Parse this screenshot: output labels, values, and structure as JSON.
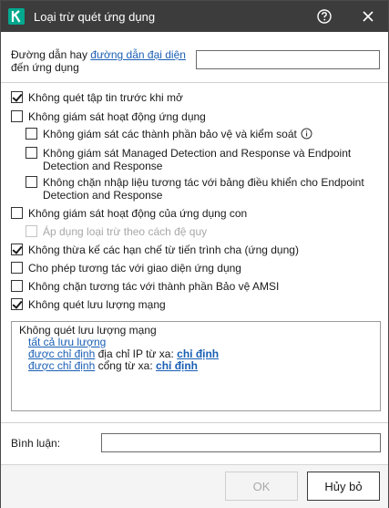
{
  "window": {
    "title": "Loại trừ quét ứng dụng",
    "icons": {
      "app": "kaspersky-logo-icon",
      "help": "help-icon",
      "close": "close-icon"
    }
  },
  "path": {
    "label_prefix": "Đường dẫn hay ",
    "label_link": "đường dẫn đại diện",
    "label_suffix": "đến ứng dụng",
    "value": ""
  },
  "options": [
    {
      "label": "Không quét tập tin trước khi mở",
      "checked": true,
      "disabled": false
    },
    {
      "label": "Không giám sát hoạt động ứng dụng",
      "checked": false,
      "disabled": false
    },
    {
      "label": "Không giám sát các thành phần bảo vệ và kiểm soát",
      "checked": false,
      "disabled": false
    },
    {
      "label": "Không giám sát Managed Detection and Response và Endpoint Detection and Response",
      "checked": false,
      "disabled": false
    },
    {
      "label": "Không chặn nhập liệu tương tác với bảng điều khiển cho Endpoint Detection and Response",
      "checked": false,
      "disabled": false
    },
    {
      "label": "Không giám sát hoạt động của ứng dụng con",
      "checked": false,
      "disabled": false
    },
    {
      "label": "Áp dụng loại trừ theo cách đệ quy",
      "checked": false,
      "disabled": true
    },
    {
      "label": "Không thừa kế các hạn chế từ tiến trình cha (ứng dụng)",
      "checked": true,
      "disabled": false
    },
    {
      "label": "Cho phép tương tác với giao diện ứng dụng",
      "checked": false,
      "disabled": false
    },
    {
      "label": "Không chặn tương tác với thành phần Bảo vệ AMSI",
      "checked": false,
      "disabled": false
    },
    {
      "label": "Không quét lưu lượng mạng",
      "checked": true,
      "disabled": false
    }
  ],
  "summary": {
    "title": "Không quét lưu lượng mạng",
    "all_traffic_link": "tất cả lưu lượng",
    "ip_line": {
      "link": "được chỉ định",
      "text": " địa chỉ IP từ xa: ",
      "bold_link": "chỉ định"
    },
    "port_line": {
      "link": "được chỉ định",
      "text": " cổng từ xa: ",
      "bold_link": "chỉ định"
    }
  },
  "comment": {
    "label": "Bình luận:",
    "value": ""
  },
  "buttons": {
    "ok": "OK",
    "cancel": "Hủy bỏ"
  },
  "colors": {
    "titlebar": "#3c3c3c",
    "brand": "#00a88e",
    "link": "#1a5fb4"
  }
}
